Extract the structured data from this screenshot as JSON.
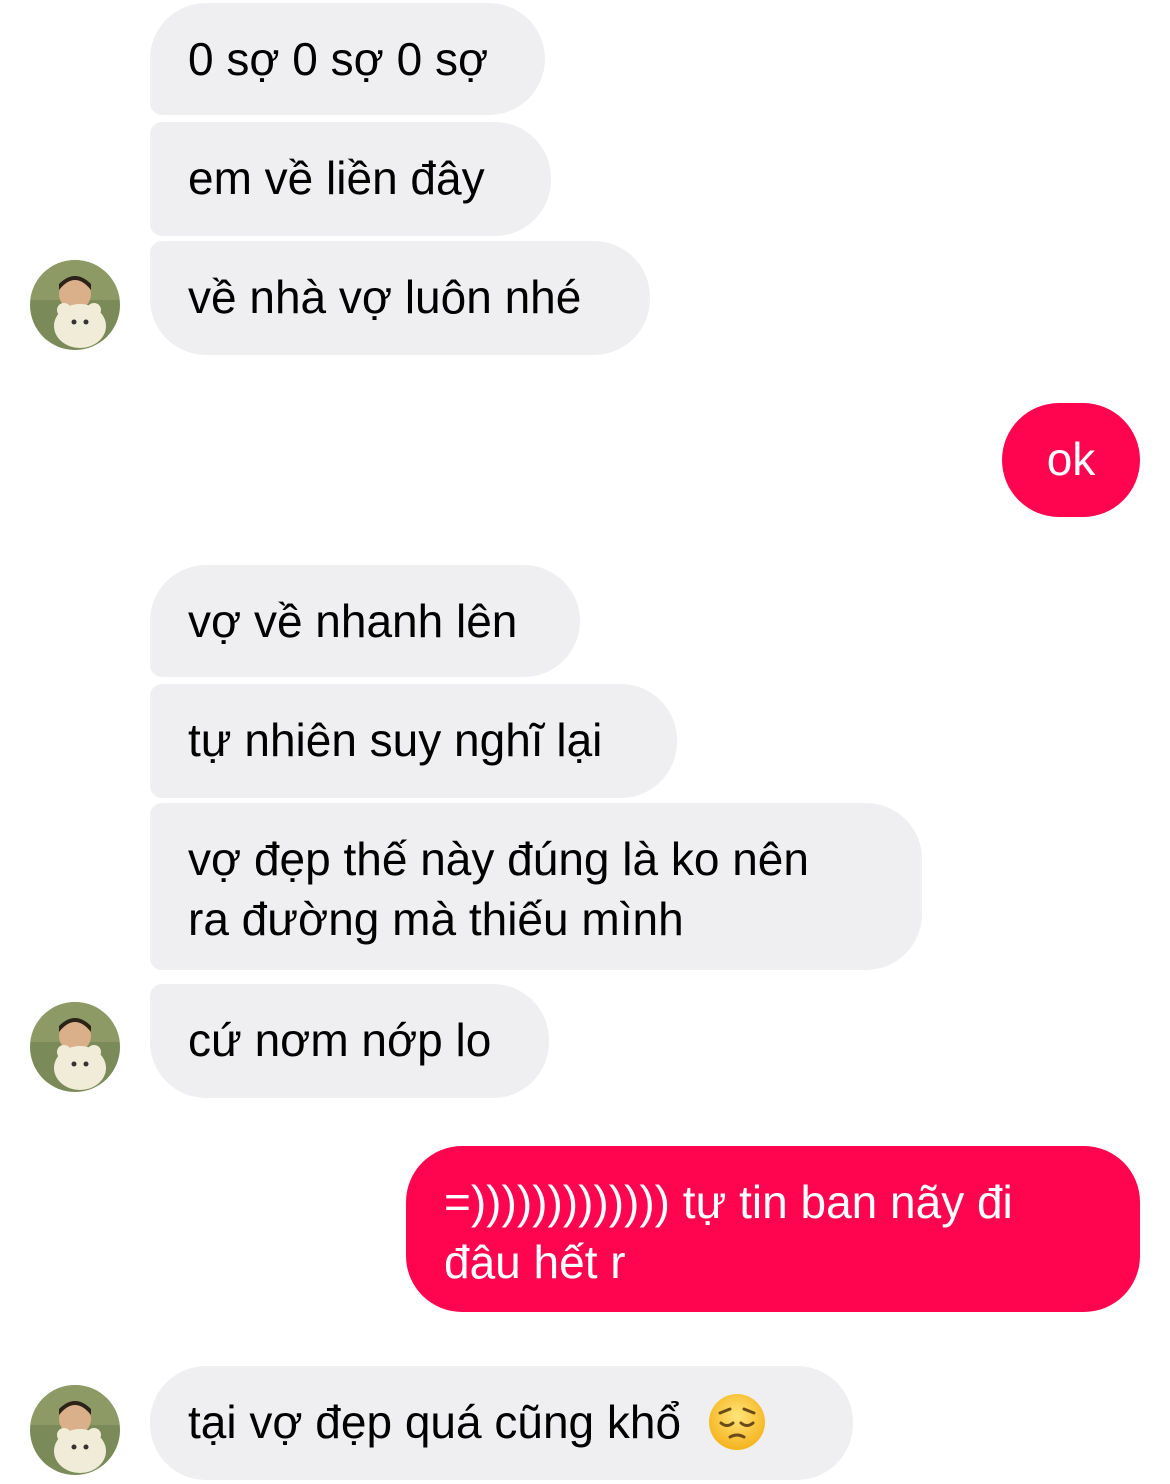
{
  "messages": [
    {
      "text": "0 sợ 0 sợ 0 sợ",
      "direction": "incoming"
    },
    {
      "text": "em về liền đây",
      "direction": "incoming"
    },
    {
      "text": "về nhà vợ luôn nhé",
      "direction": "incoming"
    },
    {
      "text": "ok",
      "direction": "outgoing"
    },
    {
      "text": "vợ về nhanh lên",
      "direction": "incoming"
    },
    {
      "text": "tự nhiên suy nghĩ lại",
      "direction": "incoming"
    },
    {
      "text": "vợ đẹp thế này đúng là ko nên",
      "text2": "ra đường mà thiếu mình",
      "direction": "incoming"
    },
    {
      "text": "cứ nơm nớp lo",
      "direction": "incoming"
    },
    {
      "text": "=))))))))))))) tự tin ban nãy đi",
      "text2": "đâu hết r",
      "direction": "outgoing"
    },
    {
      "text": "tại vợ đẹp quá cũng khổ",
      "emoji": "pensive-face-emoji",
      "direction": "incoming"
    }
  ],
  "colors": {
    "incoming_bubble": "#efeff1",
    "outgoing_bubble": "#ff0550",
    "incoming_text": "#000000",
    "outgoing_text": "#ffffff"
  },
  "icons": [
    "contact-avatar",
    "pensive-face-emoji"
  ]
}
